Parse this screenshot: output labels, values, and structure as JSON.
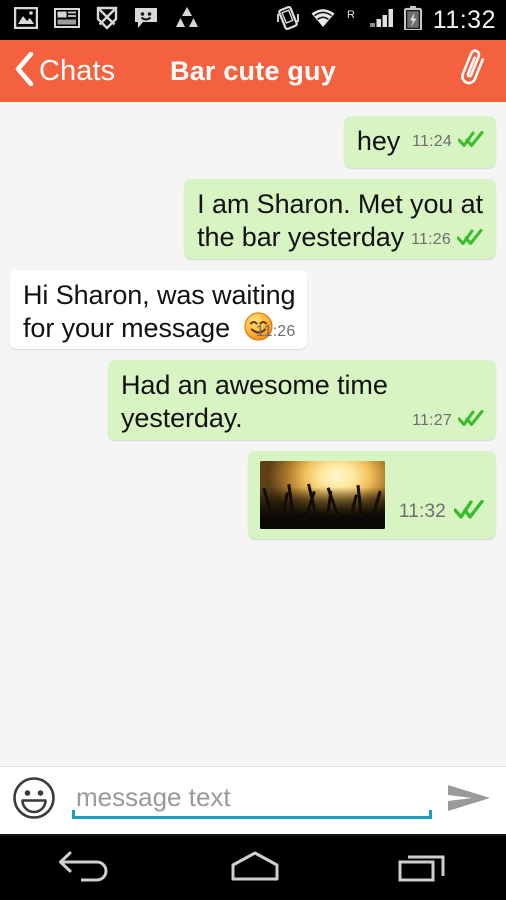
{
  "status_bar": {
    "time": "11:32",
    "left_icons": [
      {
        "name": "gallery-icon",
        "label": "Gallery"
      },
      {
        "name": "screenshot-icon",
        "label": "Screenshot captured"
      },
      {
        "name": "sync-error-icon",
        "label": "Sync problem"
      },
      {
        "name": "message-icon",
        "label": "New message"
      },
      {
        "name": "app-logo-icon",
        "label": "App notification"
      }
    ],
    "right_icons": [
      {
        "name": "vibrate-icon",
        "label": "Vibrate mode"
      },
      {
        "name": "wifi-icon",
        "label": "Wi-Fi connected"
      },
      {
        "name": "roaming-label",
        "label": "R"
      },
      {
        "name": "signal-icon",
        "label": "Mobile signal"
      },
      {
        "name": "battery-charging-icon",
        "label": "Battery charging"
      }
    ]
  },
  "header": {
    "back_label": "Chats",
    "title": "Bar cute guy",
    "attach_icon": "paperclip-icon",
    "background_color": "#f4613e"
  },
  "conversation": {
    "bubble_out_color": "#d9f4c3",
    "bubble_in_color": "#ffffff",
    "tick_color": "#39bd2b",
    "messages": [
      {
        "id": 1,
        "direction": "out",
        "type": "text",
        "text": "hey",
        "time": "11:24",
        "status": "read",
        "lines": 1
      },
      {
        "id": 2,
        "direction": "out",
        "type": "text",
        "text": "I am Sharon. Met you at the bar yesterday",
        "line1": "I am Sharon. Met you at",
        "line2": "the bar yesterday",
        "time": "11:26",
        "status": "read",
        "lines": 2
      },
      {
        "id": 3,
        "direction": "in",
        "type": "text",
        "text": "Hi Sharon, was waiting for your message",
        "line1": "Hi Sharon, was waiting",
        "line2": "for your message",
        "emoji": "smiling-face-emoji",
        "time": "11:26",
        "status": "none",
        "lines": 2
      },
      {
        "id": 4,
        "direction": "out",
        "type": "text",
        "text": "Had an awesome time yesterday.",
        "line1": "Had an awesome time",
        "line2": "yesterday.",
        "time": "11:27",
        "status": "read",
        "lines": 2
      },
      {
        "id": 5,
        "direction": "out",
        "type": "image",
        "image_description": "Concert crowd with raised hands under golden stage lights",
        "time": "11:32",
        "status": "read"
      }
    ]
  },
  "input_bar": {
    "emoji_icon": "smiley-face-icon",
    "placeholder": "message text",
    "value": "",
    "send_icon": "send-arrow-icon",
    "underline_color": "#1f9dbb"
  },
  "nav_bar": {
    "buttons": [
      {
        "name": "nav-back-button",
        "label": "Back"
      },
      {
        "name": "nav-home-button",
        "label": "Home"
      },
      {
        "name": "nav-recents-button",
        "label": "Recent apps"
      }
    ]
  }
}
